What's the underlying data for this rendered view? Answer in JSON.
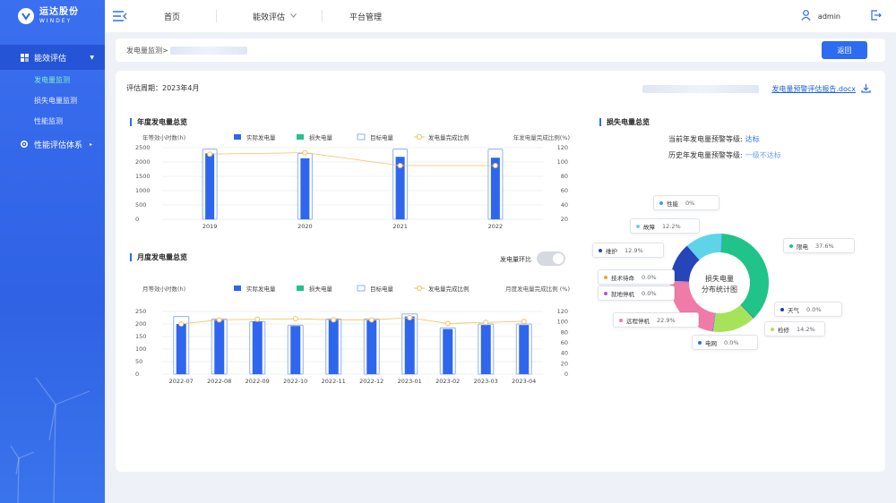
{
  "brand": {
    "name_cn": "运达股份",
    "name_en": "WINDEY"
  },
  "sidebar": {
    "group1": "能效评估",
    "sub": [
      "发电量监测",
      "损失电量监测",
      "性能监测"
    ],
    "group2": "性能评估体系"
  },
  "nav": {
    "home": "首页",
    "eval": "能效评估",
    "platform": "平台管理",
    "user": "admin"
  },
  "crumb": {
    "text": "发电量监测>",
    "back": "返回"
  },
  "period": "评估周期：2023年4月",
  "report": "发电量预警评估报告.docx",
  "annual": {
    "title": "年度发电量总览"
  },
  "monthly": {
    "title": "月度发电量总览",
    "toggle_label": "发电量环比"
  },
  "loss": {
    "title": "损失电量总览",
    "current_label": "当前年发电量预警等级:",
    "current_level": "达标",
    "history_label": "历史年发电量预警等级:",
    "history_level": "一级不达标",
    "center": [
      "损失电量",
      "分布统计图"
    ]
  },
  "legend": [
    "实际发电量",
    "损失电量",
    "目标电量",
    "发电量完成比例"
  ],
  "colors": {
    "actual": "#2f66ee",
    "loss": "#20c38a",
    "target": "#8fb0f0",
    "ratio": "#f0c25a"
  },
  "chart_data": [
    {
      "type": "bar",
      "title": "年度发电量总览",
      "ylabel": "年等效小时数(h)",
      "y2label": "年发电量完成比例(%)",
      "categories": [
        "2019",
        "2020",
        "2021",
        "2022"
      ],
      "ylim": [
        0,
        2500
      ],
      "yticks": [
        0,
        500,
        1000,
        1500,
        2000,
        2500
      ],
      "y2lim": [
        20,
        120
      ],
      "y2ticks": [
        20,
        40,
        60,
        80,
        100,
        120
      ],
      "series": [
        {
          "name": "实际发电量",
          "values": [
            2300,
            2130,
            2180,
            2150
          ]
        },
        {
          "name": "目标电量",
          "values": [
            2450,
            2300,
            2450,
            2450
          ]
        },
        {
          "name": "发电量完成比例",
          "values": [
            111,
            113,
            95,
            95
          ],
          "axis": "y2"
        }
      ]
    },
    {
      "type": "bar",
      "title": "月度发电量总览",
      "ylabel": "月等效小时数(h)",
      "y2label": "月度发电量完成比例 (%)",
      "categories": [
        "2022-07",
        "2022-08",
        "2022-09",
        "2022-10",
        "2022-11",
        "2022-12",
        "2023-01",
        "2023-02",
        "2023-03",
        "2023-04"
      ],
      "ylim": [
        0,
        250
      ],
      "yticks": [
        0,
        50,
        100,
        150,
        200,
        250
      ],
      "y2lim": [
        0,
        120
      ],
      "y2ticks": [
        0,
        20,
        40,
        60,
        80,
        100,
        120
      ],
      "series": [
        {
          "name": "实际发电量",
          "values": [
            200,
            218,
            210,
            192,
            220,
            215,
            230,
            180,
            196,
            196
          ]
        },
        {
          "name": "目标电量",
          "values": [
            230,
            220,
            210,
            195,
            220,
            220,
            240,
            185,
            200,
            200
          ]
        },
        {
          "name": "发电量完成比例",
          "values": [
            96,
            104,
            105,
            106,
            104,
            104,
            108,
            97,
            99,
            101
          ],
          "axis": "y2"
        }
      ]
    },
    {
      "type": "pie",
      "title": "损失电量总览",
      "slices": [
        {
          "name": "限电",
          "value": 37.6,
          "color": "#20c38a"
        },
        {
          "name": "天气",
          "value": 0.0,
          "color": "#1f3fa8"
        },
        {
          "name": "检修",
          "value": 14.2,
          "color": "#a6e35a"
        },
        {
          "name": "电网",
          "value": 0.0,
          "color": "#2d6cf0"
        },
        {
          "name": "远程停机",
          "value": 22.9,
          "color": "#f07aa8"
        },
        {
          "name": "就地停机",
          "value": 0.0,
          "color": "#a15bd8"
        },
        {
          "name": "技术待命",
          "value": 0.0,
          "color": "#f2a23a"
        },
        {
          "name": "维护",
          "value": 12.9,
          "color": "#2545b8"
        },
        {
          "name": "故障",
          "value": 12.2,
          "color": "#5fd3e8"
        },
        {
          "name": "性能",
          "value": 0.0,
          "color": "#3aa0e0"
        }
      ]
    }
  ]
}
